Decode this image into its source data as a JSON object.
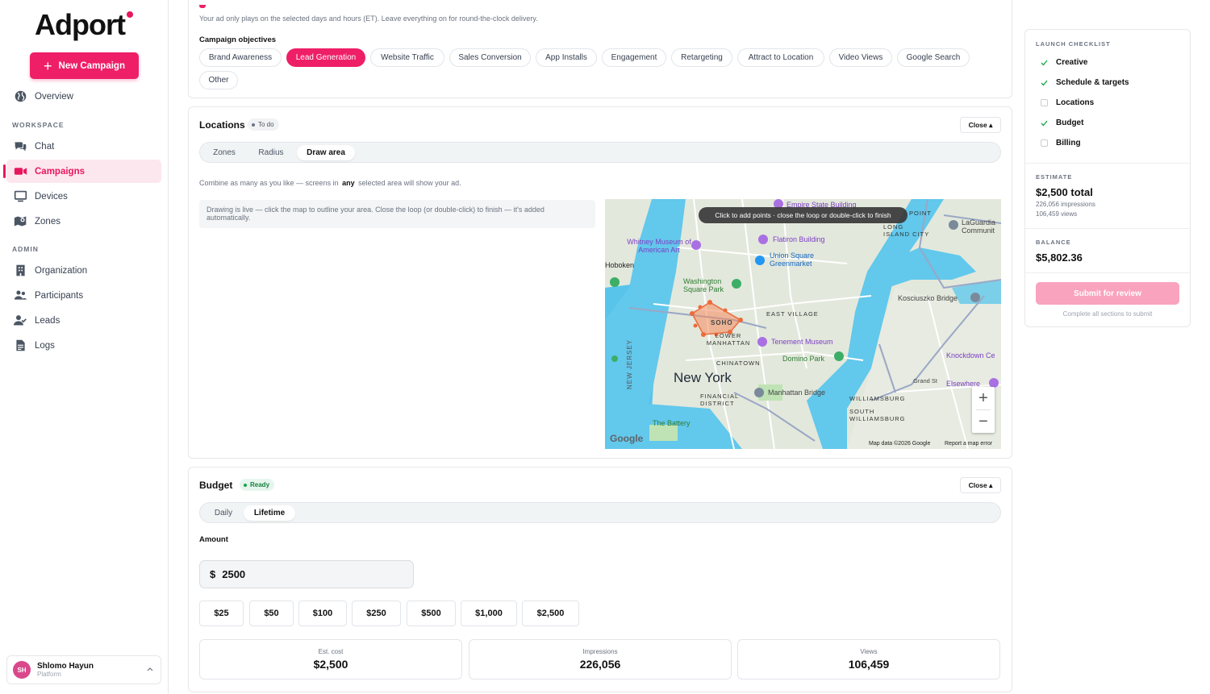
{
  "brand": {
    "name": "Adport",
    "accent": "#ee1f66"
  },
  "sidebar": {
    "new_campaign": "New Campaign",
    "overview": "Overview",
    "workspace_label": "WORKSPACE",
    "workspace_items": [
      {
        "label": "Chat",
        "icon": "chat-icon"
      },
      {
        "label": "Campaigns",
        "icon": "video-icon",
        "active": true
      },
      {
        "label": "Devices",
        "icon": "monitor-icon"
      },
      {
        "label": "Zones",
        "icon": "map-icon"
      }
    ],
    "admin_label": "ADMIN",
    "admin_items": [
      {
        "label": "Organization",
        "icon": "building-icon"
      },
      {
        "label": "Participants",
        "icon": "people-icon"
      },
      {
        "label": "Leads",
        "icon": "user-check-icon"
      },
      {
        "label": "Logs",
        "icon": "document-icon"
      }
    ],
    "user": {
      "initials": "SH",
      "name": "Shlomo Hayun",
      "role": "Platform"
    }
  },
  "schedule": {
    "hint": "Your ad only plays on the selected days and hours (ET). Leave everything on for round-the-clock delivery."
  },
  "objectives": {
    "label": "Campaign objectives",
    "items": [
      "Brand Awareness",
      "Lead Generation",
      "Website Traffic",
      "Sales Conversion",
      "App Installs",
      "Engagement",
      "Retargeting",
      "Attract to Location",
      "Video Views",
      "Google Search",
      "Other"
    ],
    "selected": "Lead Generation"
  },
  "locations": {
    "title": "Locations",
    "status": "To do",
    "close": "Close ▴",
    "tabs": [
      "Zones",
      "Radius",
      "Draw area"
    ],
    "active_tab": "Draw area",
    "combine_prefix": "Combine as many as you like — screens in",
    "combine_any": "any",
    "combine_suffix": "selected area will show your ad.",
    "draw_note": "Drawing is live — click the map to outline your area. Close the loop (or double-click) to finish — it's added automatically.",
    "map": {
      "tooltip": "Click to add points · close the loop or double-click to finish",
      "labels": {
        "new_york": "New York",
        "soho": "SOHO",
        "lower_manhattan": "LOWER MANHATTAN",
        "chinatown": "CHINATOWN",
        "east_village": "EAST VILLAGE",
        "financial_district": "FINANCIAL DISTRICT",
        "williamsburg": "WILLIAMSBURG",
        "south_williamsburg": "SOUTH WILLIAMSBURG",
        "long_island_city": "LONG ISLAND CITY",
        "hoboken": "Hoboken",
        "washington_square": "Washington Square Park",
        "union_square": "Union Square Greenmarket",
        "flatiron": "Flatiron Building",
        "whitney": "Whitney Museum of American Art",
        "tenement": "Tenement Museum",
        "domino": "Domino Park",
        "manhattan_bridge": "Manhattan Bridge",
        "kosciuszko": "Kosciuszko Bridge",
        "the_battery": "The Battery",
        "laguardia": "LaGuardia Communit",
        "knockdown": "Knockdown Ce",
        "elsewhere": "Elsewhere",
        "empire": "Empire State Building",
        "point": "POINT",
        "new_jersey": "NEW JERSEY",
        "grand_st": "Grand St"
      },
      "attribution": "Map data ©2026 Google",
      "report": "Report a map error",
      "google": "Google"
    }
  },
  "budget": {
    "title": "Budget",
    "status": "Ready",
    "close": "Close ▴",
    "tabs": [
      "Daily",
      "Lifetime"
    ],
    "active_tab": "Lifetime",
    "amount_label": "Amount",
    "currency": "$",
    "amount": "2500",
    "presets": [
      "$25",
      "$50",
      "$100",
      "$250",
      "$500",
      "$1,000",
      "$2,500"
    ],
    "stats": [
      {
        "label": "Est. cost",
        "value": "$2,500"
      },
      {
        "label": "Impressions",
        "value": "226,056"
      },
      {
        "label": "Views",
        "value": "106,459"
      }
    ]
  },
  "checklist": {
    "label": "LAUNCH CHECKLIST",
    "items": [
      {
        "label": "Creative",
        "done": true
      },
      {
        "label": "Schedule & targets",
        "done": true
      },
      {
        "label": "Locations",
        "done": false
      },
      {
        "label": "Budget",
        "done": true
      },
      {
        "label": "Billing",
        "done": false
      }
    ],
    "estimate_label": "ESTIMATE",
    "estimate_total": "$2,500 total",
    "estimate_impressions": "226,056 impressions",
    "estimate_views": "106,459 views",
    "balance_label": "BALANCE",
    "balance": "$5,802.36",
    "submit": "Submit for review",
    "submit_hint": "Complete all sections to submit"
  }
}
